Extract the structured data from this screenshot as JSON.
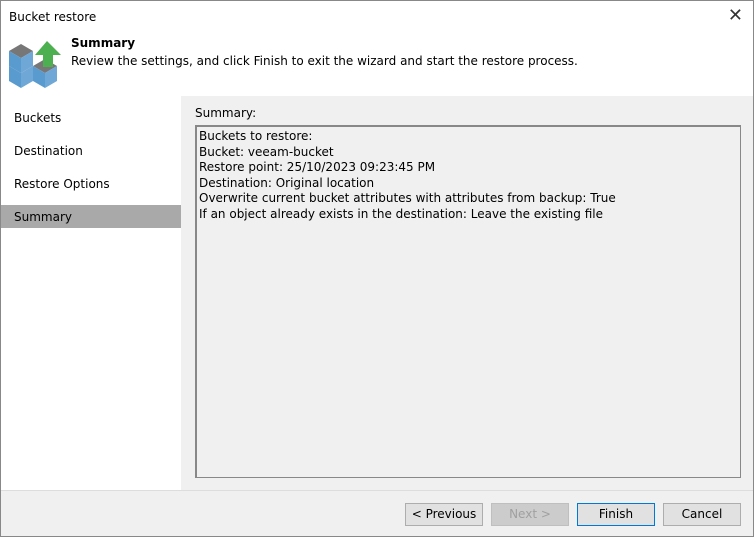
{
  "window": {
    "title": "Bucket restore"
  },
  "header": {
    "title": "Summary",
    "description": "Review the settings, and click Finish to exit the wizard and start the restore process."
  },
  "sidebar": {
    "items": [
      {
        "label": "Buckets"
      },
      {
        "label": "Destination"
      },
      {
        "label": "Restore Options"
      },
      {
        "label": "Summary",
        "selected": true
      }
    ]
  },
  "summary": {
    "label": "Summary:",
    "lines": [
      "Buckets to restore:",
      "Bucket: veeam-bucket",
      "Restore point: 25/10/2023 09:23:45 PM",
      "Destination: Original location",
      "Overwrite current bucket attributes with attributes from backup: True",
      "If an object already exists in the destination: Leave the existing file"
    ]
  },
  "buttons": {
    "previous": "< Previous",
    "next": "Next >",
    "finish": "Finish",
    "cancel": "Cancel"
  }
}
